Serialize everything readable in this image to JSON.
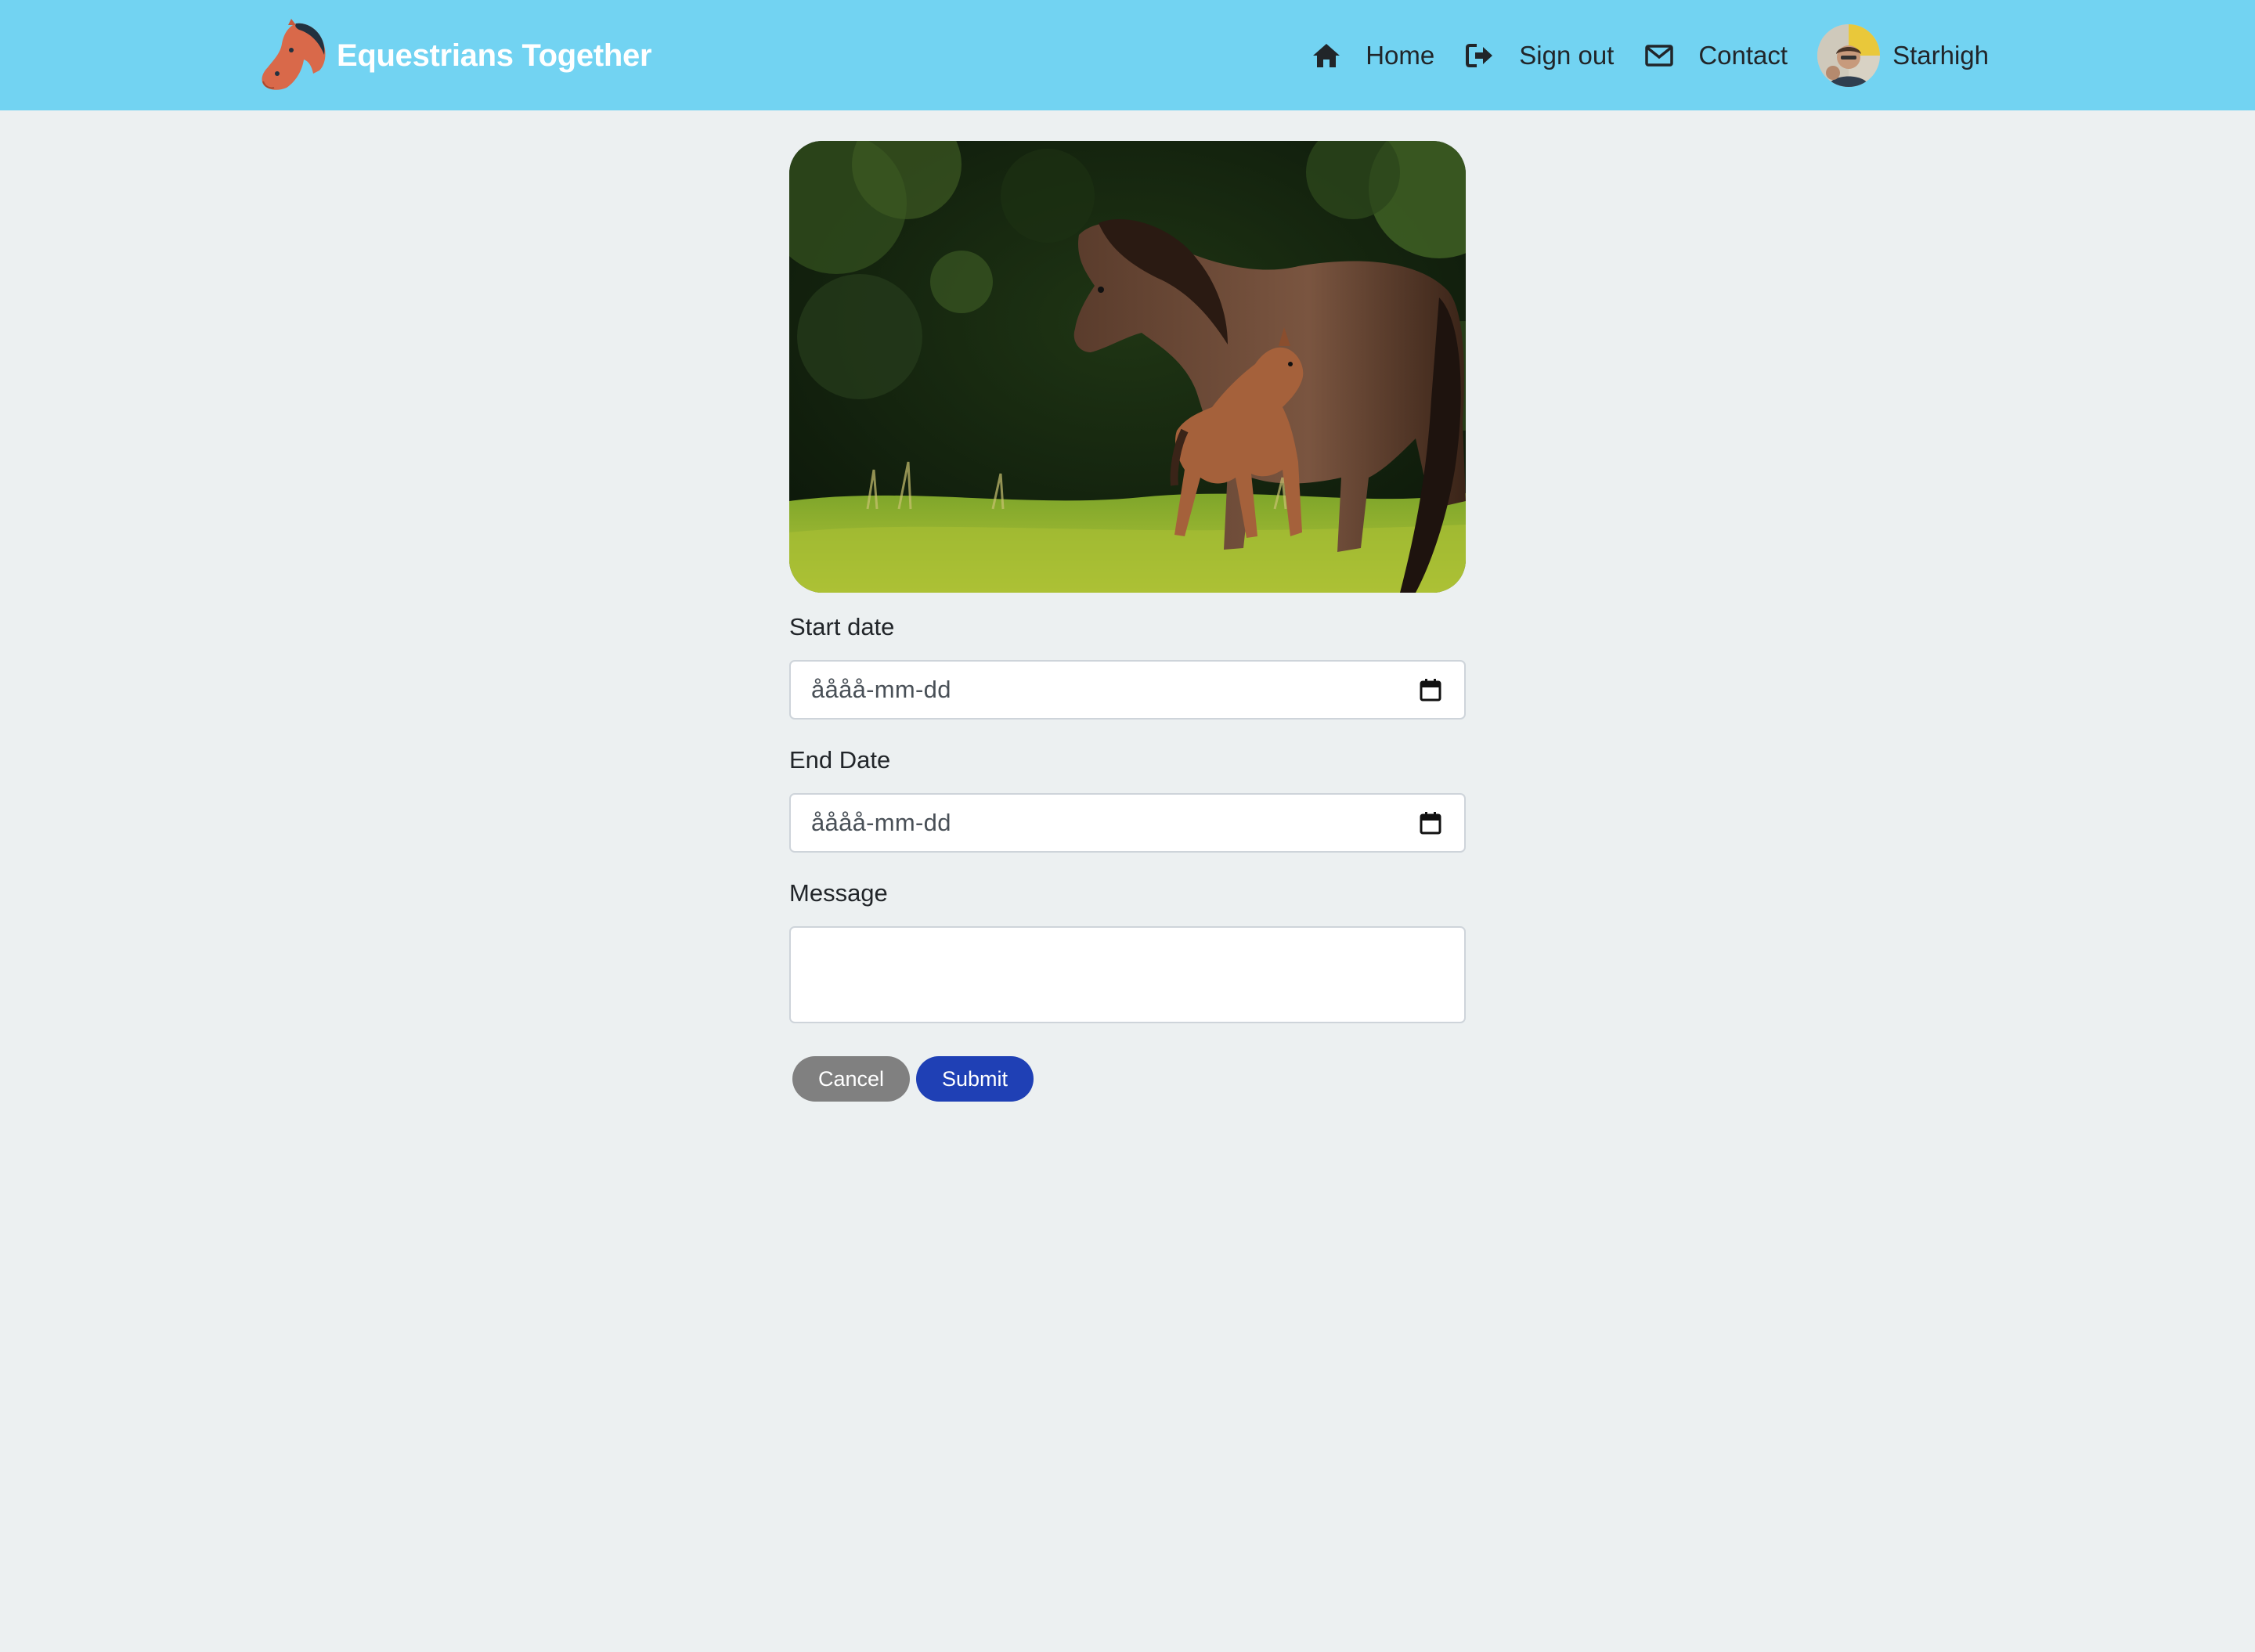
{
  "navbar": {
    "brand_name": "Equestrians Together",
    "brand_icon": "horse-head-logo",
    "background_color": "#72d3f2",
    "links": [
      {
        "label": "Home",
        "icon": "home-icon"
      },
      {
        "label": "Sign out",
        "icon": "sign-out-icon"
      },
      {
        "label": "Contact",
        "icon": "envelope-icon"
      }
    ],
    "user": {
      "name": "Starhigh",
      "icon": "avatar"
    }
  },
  "form": {
    "start_date": {
      "label": "Start date",
      "value": "åååå-mm-dd"
    },
    "end_date": {
      "label": "End Date",
      "value": "åååå-mm-dd"
    },
    "message": {
      "label": "Message",
      "value": ""
    },
    "cancel_label": "Cancel",
    "submit_label": "Submit",
    "cancel_color": "#808080",
    "submit_color": "#1f40b5"
  }
}
